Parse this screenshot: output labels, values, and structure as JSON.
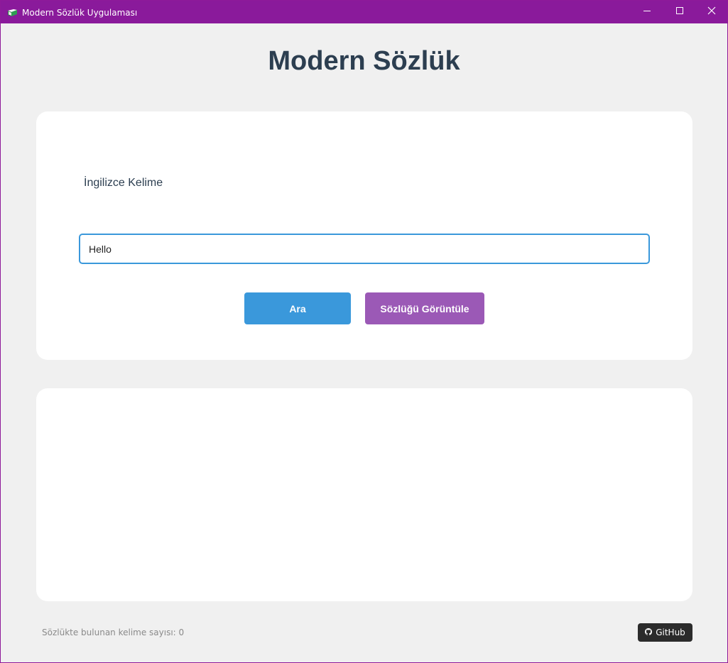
{
  "window": {
    "title": "Modern Sözlük Uygulaması",
    "icon": "book-icon",
    "controls": [
      "minimize-icon",
      "maximize-icon",
      "close-icon"
    ],
    "accent_color": "#8a1a9b"
  },
  "main": {
    "heading": "Modern Sözlük",
    "search": {
      "label": "İngilizce Kelime",
      "input_value": "Hello",
      "search_button": "Ara",
      "view_button": "Sözlüğü Görüntüle"
    },
    "colors": {
      "heading": "#2c3e50",
      "search_button": "#3a98db",
      "view_button": "#9b59b6",
      "input_border": "#3a98db"
    }
  },
  "footer": {
    "word_count_text": "Sözlükte bulunan kelime sayısı: 0",
    "github_label": "GitHub",
    "github_icon": "github-icon"
  }
}
